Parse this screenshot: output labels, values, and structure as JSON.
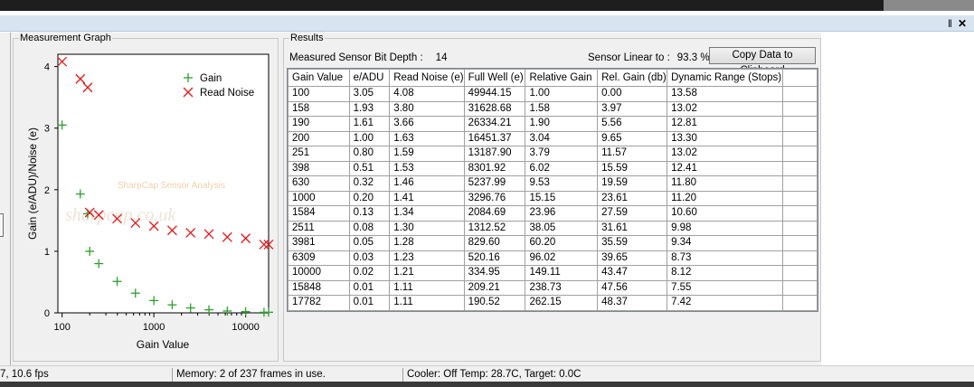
{
  "window": {
    "pin_glyph": "‖",
    "close_glyph": "✕"
  },
  "graph": {
    "group_title": "Measurement Graph",
    "watermark_text": "SharpCap Sensor Analysis",
    "watermark_url": "sharpcap.co.uk",
    "colors": {
      "gain": "#2ca02c",
      "read_noise": "#e41a1c"
    }
  },
  "chart_data": {
    "type": "scatter",
    "xscale": "log",
    "xlabel": "Gain Value",
    "ylabel": "Gain (e/ADU)/Noise (e)",
    "xlim": [
      90,
      17782
    ],
    "ylim": [
      0,
      4.2
    ],
    "x_ticks": [
      100,
      1000,
      10000
    ],
    "y_ticks": [
      0,
      1,
      2,
      3,
      4
    ],
    "legend_position": "top-right",
    "series": [
      {
        "name": "Gain",
        "marker": "+",
        "x": [
          100,
          158,
          190,
          200,
          251,
          398,
          630,
          1000,
          1584,
          2511,
          3981,
          6309,
          10000,
          15848,
          17782
        ],
        "values": [
          3.05,
          1.93,
          1.61,
          1.0,
          0.8,
          0.51,
          0.32,
          0.2,
          0.13,
          0.08,
          0.05,
          0.03,
          0.02,
          0.01,
          0.01
        ]
      },
      {
        "name": "Read Noise",
        "marker": "x",
        "x": [
          100,
          158,
          190,
          200,
          251,
          398,
          630,
          1000,
          1584,
          2511,
          3981,
          6309,
          10000,
          15848,
          17782
        ],
        "values": [
          4.08,
          3.8,
          3.66,
          1.63,
          1.59,
          1.53,
          1.46,
          1.41,
          1.34,
          1.3,
          1.28,
          1.23,
          1.21,
          1.11,
          1.11
        ]
      }
    ]
  },
  "results": {
    "group_title": "Results",
    "bit_depth_label": "Measured Sensor Bit Depth :",
    "bit_depth_value": "14",
    "linear_label": "Sensor Linear to :",
    "linear_value": "93.3 %",
    "copy_button": "Copy Data to Clipboard",
    "columns": [
      "Gain Value",
      "e/ADU",
      "Read Noise (e)",
      "Full Well (e)",
      "Relative Gain",
      "Rel. Gain (db)",
      "Dynamic Range (Stops)",
      ""
    ],
    "rows": [
      [
        "100",
        "3.05",
        "4.08",
        "49944.15",
        "1.00",
        "0.00",
        "13.58",
        ""
      ],
      [
        "158",
        "1.93",
        "3.80",
        "31628.68",
        "1.58",
        "3.97",
        "13.02",
        ""
      ],
      [
        "190",
        "1.61",
        "3.66",
        "26334.21",
        "1.90",
        "5.56",
        "12.81",
        ""
      ],
      [
        "200",
        "1.00",
        "1.63",
        "16451.37",
        "3.04",
        "9.65",
        "13.30",
        ""
      ],
      [
        "251",
        "0.80",
        "1.59",
        "13187.90",
        "3.79",
        "11.57",
        "13.02",
        ""
      ],
      [
        "398",
        "0.51",
        "1.53",
        "8301.92",
        "6.02",
        "15.59",
        "12.41",
        ""
      ],
      [
        "630",
        "0.32",
        "1.46",
        "5237.99",
        "9.53",
        "19.59",
        "11.80",
        ""
      ],
      [
        "1000",
        "0.20",
        "1.41",
        "3296.76",
        "15.15",
        "23.61",
        "11.20",
        ""
      ],
      [
        "1584",
        "0.13",
        "1.34",
        "2084.69",
        "23.96",
        "27.59",
        "10.60",
        ""
      ],
      [
        "2511",
        "0.08",
        "1.30",
        "1312.52",
        "38.05",
        "31.61",
        "9.98",
        ""
      ],
      [
        "3981",
        "0.05",
        "1.28",
        "829.60",
        "60.20",
        "35.59",
        "9.34",
        ""
      ],
      [
        "6309",
        "0.03",
        "1.23",
        "520.16",
        "96.02",
        "39.65",
        "8.73",
        ""
      ],
      [
        "10000",
        "0.02",
        "1.21",
        "334.95",
        "149.11",
        "43.47",
        "8.12",
        ""
      ],
      [
        "15848",
        "0.01",
        "1.11",
        "209.21",
        "238.73",
        "47.56",
        "7.55",
        ""
      ],
      [
        "17782",
        "0.01",
        "1.11",
        "190.52",
        "262.15",
        "48.37",
        "7.42",
        ""
      ],
      [
        "",
        "",
        "",
        "",
        "",
        "",
        "",
        ""
      ]
    ]
  },
  "status": {
    "fps": "7, 10.6 fps",
    "memory": "Memory: 2 of 237 frames in use.",
    "cooler": "Cooler: Off Temp: 28.7C, Target: 0.0C"
  }
}
